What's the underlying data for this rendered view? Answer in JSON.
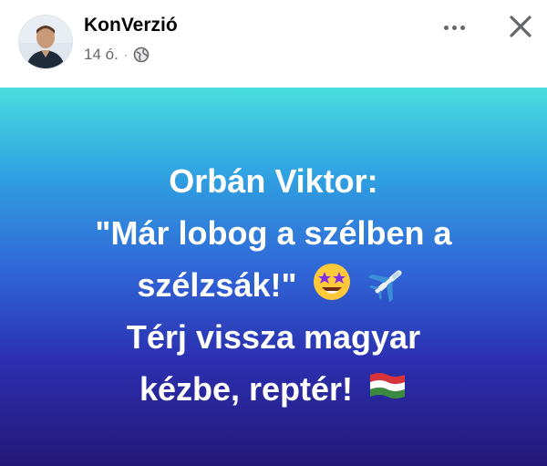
{
  "post": {
    "author": "KonVerzió",
    "time": "14 ó.",
    "separator": "·",
    "icons": {
      "avatar": "profile-photo",
      "privacy": "globe-icon",
      "more": "more-options-icon",
      "close": "close-icon"
    },
    "text_lines": [
      "Orbán Viktor:",
      "\"Már lobog a szélben a",
      "szélzsák!\"",
      "Térj vissza magyar",
      "kézbe, reptér!"
    ],
    "emojis": [
      "star-struck-emoji",
      "airplane-emoji",
      "hungary-flag-emoji"
    ],
    "background_gradient": [
      "#49dfe0",
      "#2f9fe1",
      "#3067d7",
      "#2b2fb0",
      "#251777"
    ]
  }
}
